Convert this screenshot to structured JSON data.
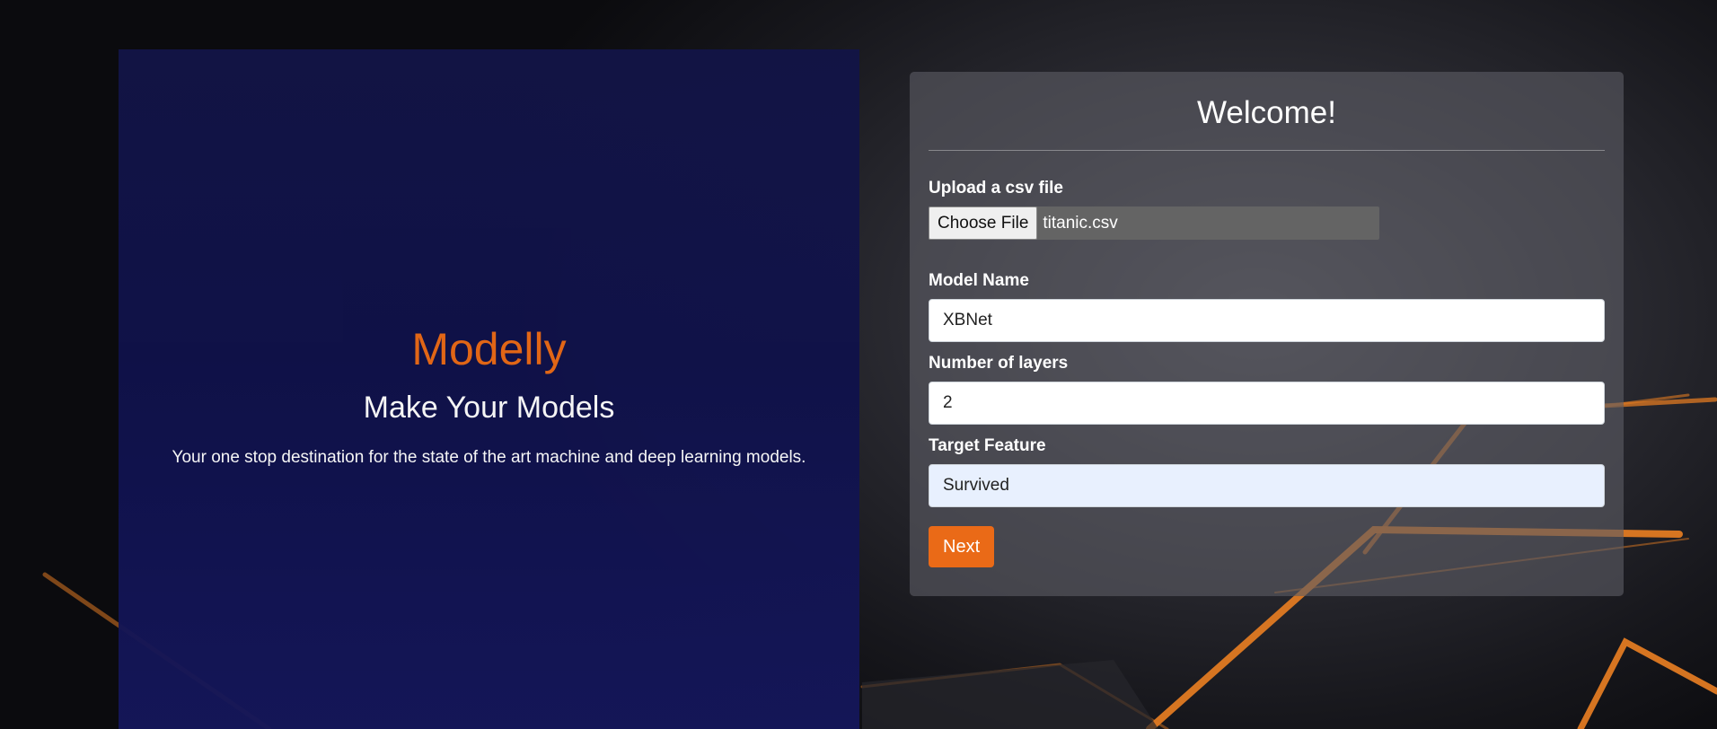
{
  "hero": {
    "title": "Modelly",
    "subtitle": "Make Your Models",
    "description": "Your one stop destination for the state of the art machine and deep learning models."
  },
  "form": {
    "heading": "Welcome!",
    "upload_label": "Upload a csv file",
    "choose_file_button": "Choose File",
    "file_name": "titanic.csv",
    "model_name_label": "Model Name",
    "model_name_value": "XBNet",
    "layers_label": "Number of layers",
    "layers_value": "2",
    "target_label": "Target Feature",
    "target_value": "Survived",
    "next_button": "Next"
  },
  "colors": {
    "accent": "#ea6a17",
    "hero_bg": "#121446",
    "card_bg": "#5c5c64",
    "autofill_bg": "#e8f0fe"
  }
}
